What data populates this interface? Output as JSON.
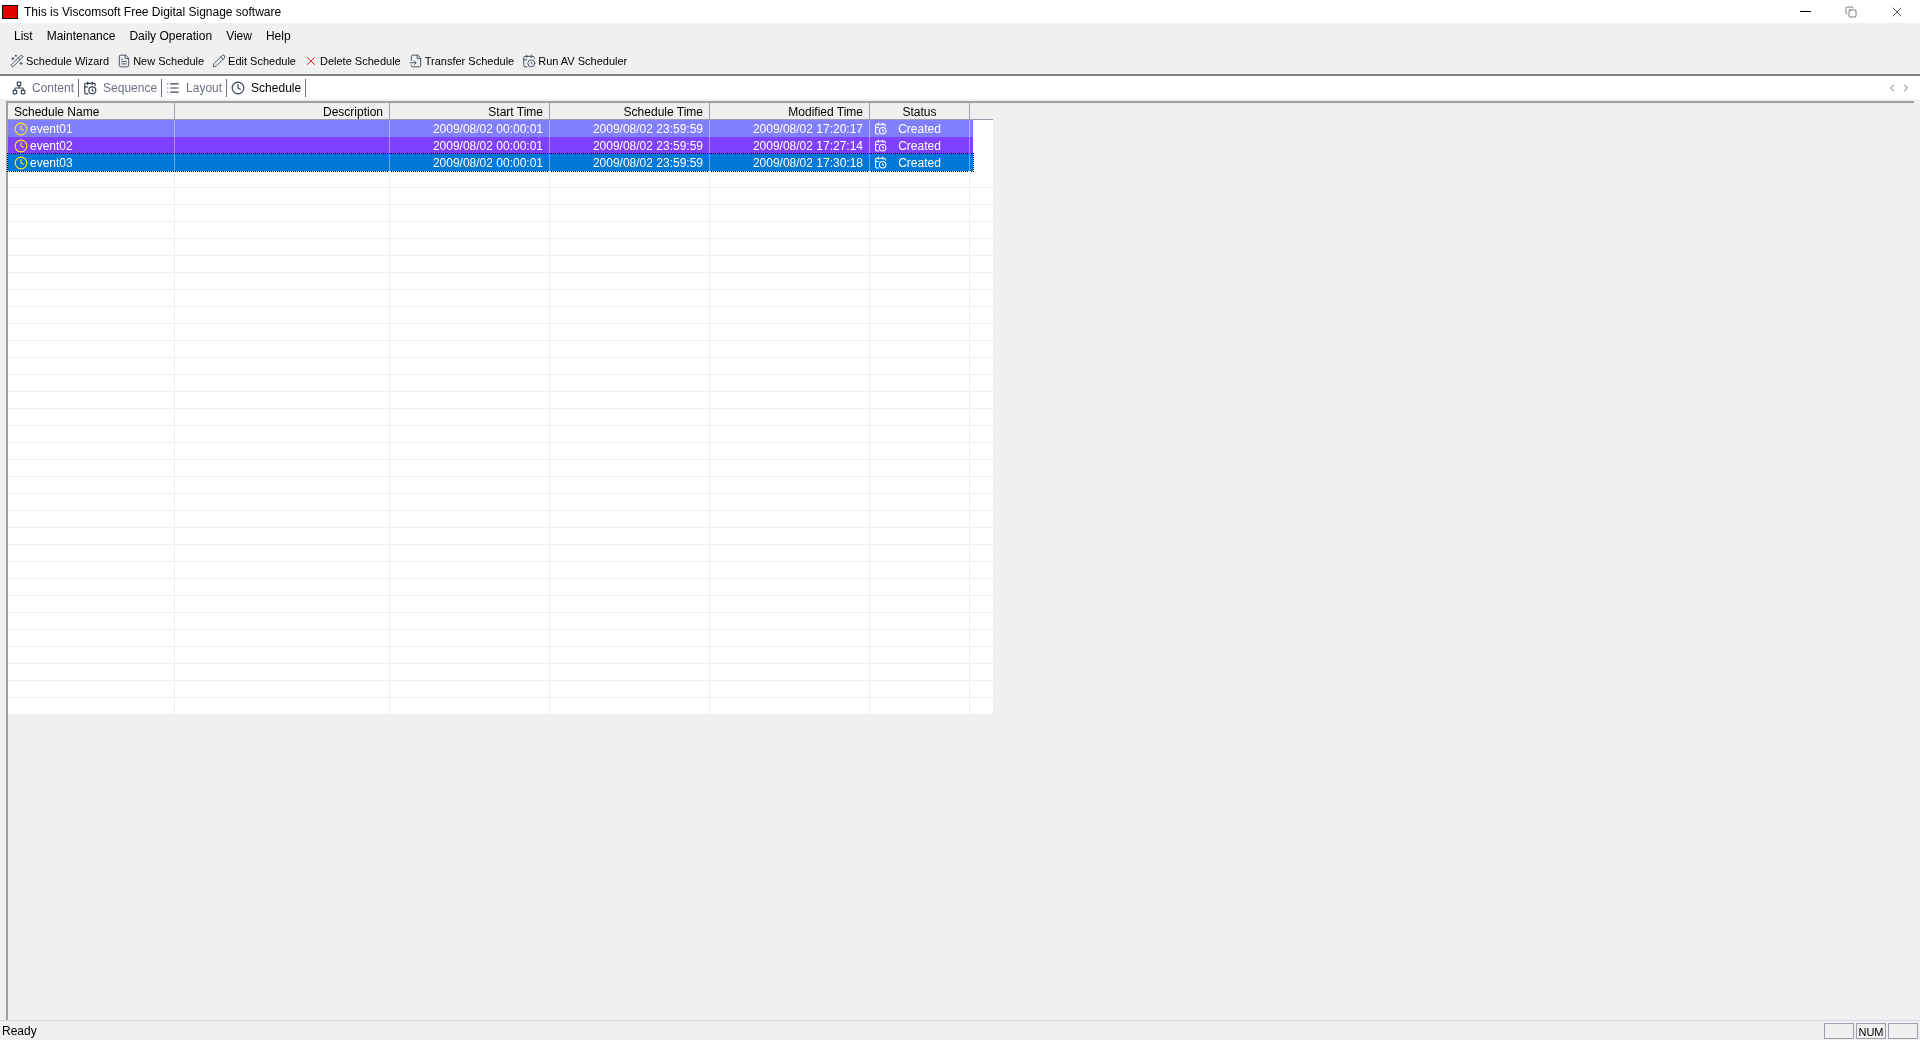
{
  "window": {
    "title": "This is Viscomsoft Free Digital Signage software"
  },
  "menu": [
    "List",
    "Maintenance",
    "Daily Operation",
    "View",
    "Help"
  ],
  "toolbar": [
    "Schedule Wizard",
    "New Schedule",
    "Edit Schedule",
    "Delete Schedule",
    "Transfer Schedule",
    "Run AV Scheduler"
  ],
  "tabs": [
    {
      "label": "Content",
      "selected": false
    },
    {
      "label": "Sequence",
      "selected": false
    },
    {
      "label": "Layout",
      "selected": false
    },
    {
      "label": "Schedule",
      "selected": true
    }
  ],
  "table": {
    "columns": [
      "Schedule Name",
      "Description",
      "Start Time",
      "Schedule Time",
      "Modified Time",
      "Status"
    ],
    "rows": [
      {
        "name": "event01",
        "start": "2009/08/02 00:00:01",
        "schedule": "2009/08/02 23:59:59",
        "modified": "2009/08/02 17:20:17",
        "status": "Created",
        "color": "#8080ff",
        "selected": false
      },
      {
        "name": "event02",
        "start": "2009/08/02 00:00:01",
        "schedule": "2009/08/02 23:59:59",
        "modified": "2009/08/02 17:27:14",
        "status": "Created",
        "color": "#8040ff",
        "selected": false
      },
      {
        "name": "event03",
        "start": "2009/08/02 00:00:01",
        "schedule": "2009/08/02 23:59:59",
        "modified": "2009/08/02 17:30:18",
        "status": "Created",
        "color": "#0078d7",
        "selected": true
      }
    ]
  },
  "status_bar": {
    "text": "Ready",
    "indicators": [
      "NUM"
    ]
  }
}
